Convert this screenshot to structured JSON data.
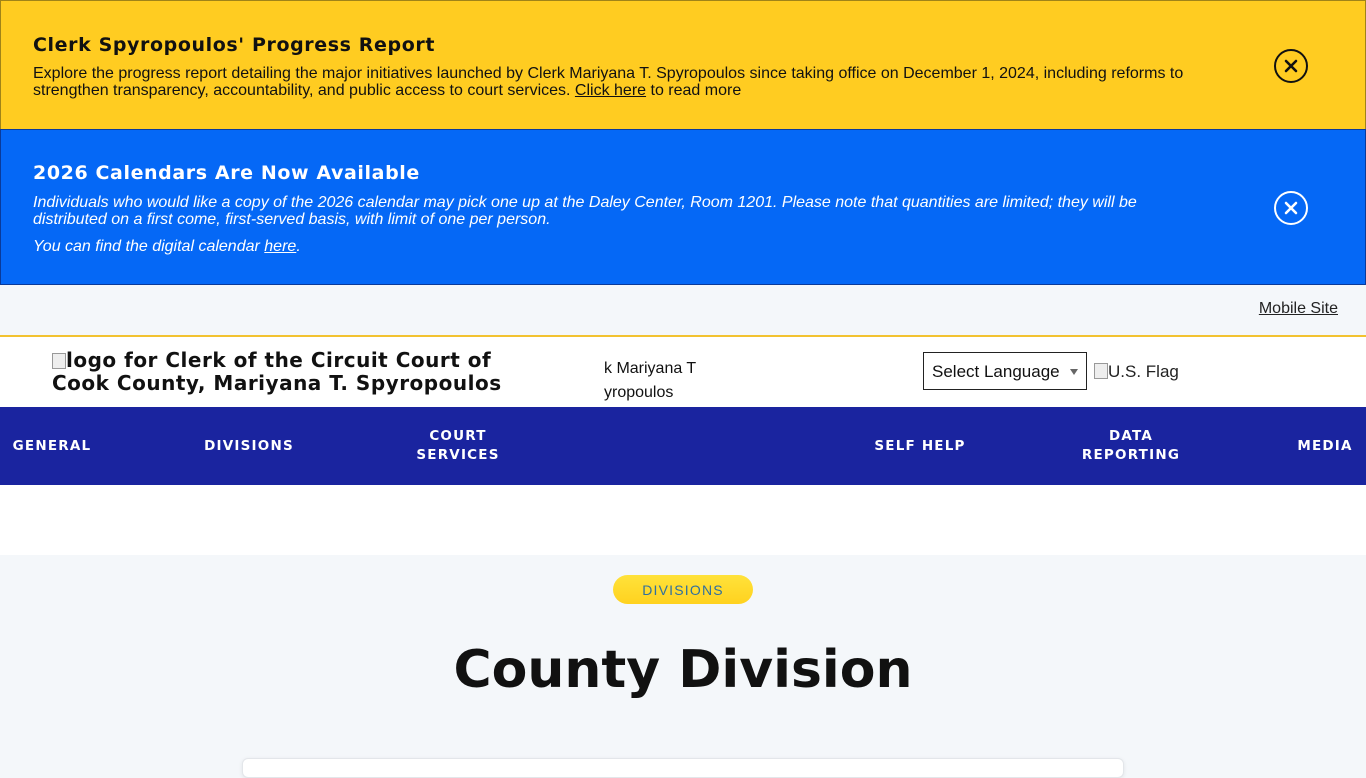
{
  "alerts": {
    "progress": {
      "title": "Clerk Spyropoulos' Progress Report",
      "body": "Explore the progress report detailing the major initiatives launched by Clerk Mariyana T. Spyropoulos since taking office on December 1, 2024, including reforms to strengthen transparency, accountability, and public access to court services.",
      "link_text": "Click here",
      "link_suffix": " to read more"
    },
    "calendar": {
      "title": "2026 Calendars Are Now Available",
      "body": "Individuals who would like a copy of the 2026 calendar may pick one up at the Daley Center, Room 1201. Please note that quantities are limited; they will be distributed on a first come, first-served basis, with limit of one per person.",
      "body2_prefix": "You can find the digital calendar ",
      "link_text": "here",
      "body2_suffix": "."
    }
  },
  "topbar": {
    "mobile_link": "Mobile Site"
  },
  "header": {
    "logo_alt": "logo for Clerk of the Circuit Court of Cook County, Mariyana T. Spyropoulos",
    "mid_alt_line1": "k Mariyana T",
    "mid_alt_line2": "yropoulos",
    "language_select": "Select Language",
    "flag_alt": "U.S. Flag"
  },
  "nav": {
    "items": [
      {
        "label": "GENERAL"
      },
      {
        "label": "DIVISIONS"
      },
      {
        "label": "COURT SERVICES"
      },
      {
        "label": "SELF HELP"
      },
      {
        "label": "DATA REPORTING"
      },
      {
        "label": "MEDIA"
      }
    ]
  },
  "main": {
    "badge": "DIVISIONS",
    "title": "County Division"
  },
  "colors": {
    "alert_yellow": "#ffcc21",
    "alert_blue": "#0568f6",
    "nav_bg": "#1a249f",
    "badge_bg": "#ffd21f",
    "badge_text": "#2f6f9f"
  }
}
